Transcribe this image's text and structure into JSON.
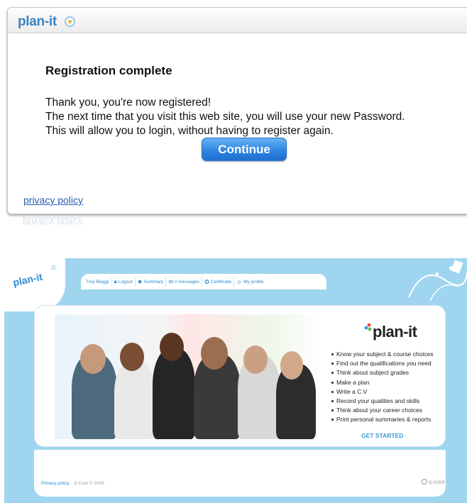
{
  "top": {
    "brand": "plan-it",
    "title": "Registration complete",
    "message_lines": [
      "Thank you, you're now registered!",
      "The next time that you visit this web site, you will use your new Password.",
      "This will allow you to login, without having to register again."
    ],
    "continue_label": "Continue",
    "privacy_label": "privacy policy"
  },
  "site": {
    "logo": "plan-it",
    "tabs": [
      {
        "icon": "user-icon",
        "label": "Troy Blaggi"
      },
      {
        "icon": "lock-icon",
        "label": "Logout"
      },
      {
        "icon": "gear-icon",
        "label": "Summary"
      },
      {
        "icon": "envelope-icon",
        "label": "0 messages"
      },
      {
        "icon": "ribbon-icon",
        "label": "Certificate"
      },
      {
        "icon": "profile-icon",
        "label": "My profile"
      }
    ],
    "card_logo": "plan-it",
    "features": [
      "Know your subject & course choices",
      "Find out the qualifications you need",
      "Think about subject grades",
      "Make a plan",
      "Write a C.V",
      "Record your qualities and skills",
      "Think about your career choices",
      "Print personal summaries & reports"
    ],
    "get_started": "GET STARTED",
    "footer_privacy": "Privacy policy",
    "footer_copy": "S-Cool © 2009",
    "scool": "s-cool"
  },
  "colors": {
    "accent": "#2a8cd4",
    "background_site": "#9fd5ef",
    "button": "#2f86e0"
  }
}
